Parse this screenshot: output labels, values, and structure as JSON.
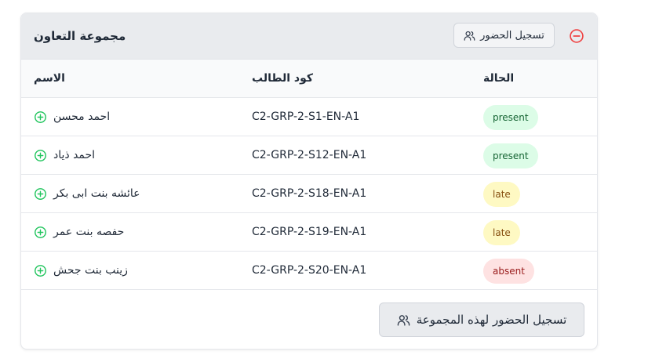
{
  "group": {
    "title": "مجموعة التعاون",
    "header_button_label": "تسجيل الحضور"
  },
  "table": {
    "headers": {
      "name": "الاسم",
      "code": "كود الطالب",
      "status": "الحالة"
    },
    "rows": [
      {
        "name": "احمد محسن",
        "code": "C2-GRP-2-S1-EN-A1",
        "status": "present"
      },
      {
        "name": "احمد ذياد",
        "code": "C2-GRP-2-S12-EN-A1",
        "status": "present"
      },
      {
        "name": "عائشه بنت ابى بكر",
        "code": "C2-GRP-2-S18-EN-A1",
        "status": "late"
      },
      {
        "name": "حفصه بنت عمر",
        "code": "C2-GRP-2-S19-EN-A1",
        "status": "late"
      },
      {
        "name": "زينب بنت جحش",
        "code": "C2-GRP-2-S20-EN-A1",
        "status": "absent"
      }
    ]
  },
  "footer": {
    "button_label": "تسجيل الحضور لهذه المجموعة"
  },
  "colors": {
    "present_bg": "#dcfce7",
    "present_text": "#166534",
    "late_bg": "#fef9c3",
    "late_text": "#854d0e",
    "absent_bg": "#fee2e2",
    "absent_text": "#991b1b",
    "add_icon": "#22c55e",
    "collapse_icon": "#ef4444"
  },
  "icons": {
    "add": "plus-circle-icon",
    "collapse": "minus-circle-icon",
    "users": "users-icon"
  }
}
